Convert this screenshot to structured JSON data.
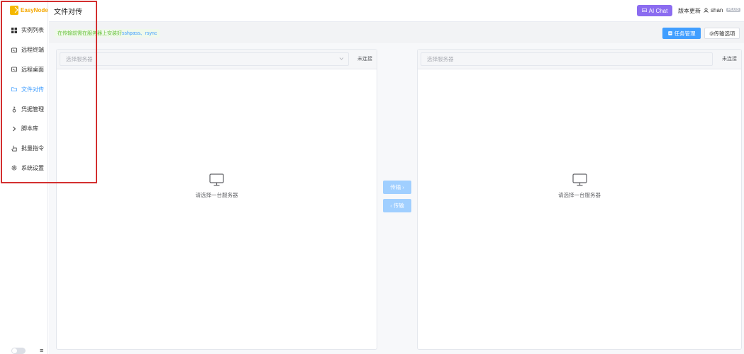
{
  "app": {
    "name": "EasyNode"
  },
  "sidebar": {
    "items": [
      {
        "label": "实例列表",
        "icon": "grid-icon"
      },
      {
        "label": "远程终端",
        "icon": "terminal-icon"
      },
      {
        "label": "远程桌面",
        "icon": "desktop-icon"
      },
      {
        "label": "文件对传",
        "icon": "folder-icon",
        "active": true
      },
      {
        "label": "凭据管理",
        "icon": "key-icon"
      },
      {
        "label": "脚本库",
        "icon": "chevron-right-icon"
      },
      {
        "label": "批量指令",
        "icon": "pointer-icon"
      },
      {
        "label": "系统设置",
        "icon": "gear-icon"
      }
    ],
    "fold_glyph": "≡"
  },
  "header": {
    "title": "文件对传",
    "ai_chat": "AI Chat",
    "update": "版本更新",
    "user": "shan",
    "badge": "PLUS"
  },
  "toolbar": {
    "notice_prefix": "在传输前需在服务器上安装好 ",
    "notice_highlight": "sshpass、rsync",
    "task_button": "任务管理",
    "options_button": "传输选项"
  },
  "left_panel": {
    "placeholder": "选择服务器",
    "status": "未连接",
    "empty": "请选择一台服务器"
  },
  "right_panel": {
    "placeholder": "选择服务器",
    "status": "未连接",
    "empty": "请选择一台服务器"
  },
  "transfer": {
    "to_right": "传输 ›",
    "to_left": "‹ 传输"
  },
  "colors": {
    "accent": "#409eff",
    "ai": "#8b6cf0",
    "logo": "#f5b800",
    "highlight": "#d32f2f"
  }
}
